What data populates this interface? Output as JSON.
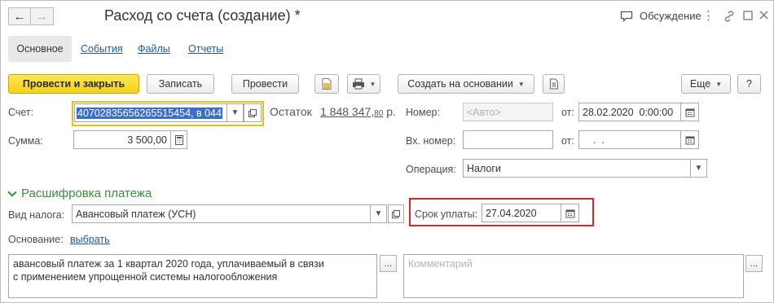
{
  "window": {
    "title": "Расход со счета (создание) *",
    "discussion_label": "Обсуждение"
  },
  "tabs": [
    {
      "label": "Основное",
      "active": true
    },
    {
      "label": "События"
    },
    {
      "label": "Файлы"
    },
    {
      "label": "Отчеты"
    }
  ],
  "toolbar": {
    "post_close": "Провести и закрыть",
    "save": "Записать",
    "post": "Провести",
    "create_based": "Создать на основании",
    "more": "Еще",
    "help": "?"
  },
  "form": {
    "account_label": "Счет:",
    "account_value": "40702835656265515454, в 044",
    "balance_label": "Остаток",
    "balance_main": "1 848 347,",
    "balance_cents": "80",
    "balance_currency": "р.",
    "number_label": "Номер:",
    "number_placeholder": "<Авто>",
    "from_label": "от:",
    "date_value": "28.02.2020  0:00:00",
    "sum_label": "Сумма:",
    "sum_value": "3 500,00",
    "incoming_number_label": "Вх. номер:",
    "incoming_number_value": "",
    "from_label2": "от:",
    "incoming_date_value": "  .  .",
    "operation_label": "Операция:",
    "operation_value": "Налоги"
  },
  "payment_section": {
    "title": "Расшифровка платежа",
    "tax_type_label": "Вид налога:",
    "tax_type_value": "Авансовый платеж (УСН)",
    "due_date_label": "Срок уплаты:",
    "due_date_value": "27.04.2020",
    "basis_label": "Основание:",
    "basis_link": "выбрать",
    "purpose_line1": "авансовый платеж за 1 квартал 2020 года, уплачиваемый в связи",
    "purpose_line2": "с применением упрощенной системы налогообложения",
    "comment_placeholder": "Комментарий"
  },
  "colors": {
    "accent_yellow": "#f3d214",
    "link_blue": "#1f59a8",
    "section_green": "#3a8f3a",
    "highlight_red": "#d9262b",
    "focus_yellow": "#e8c21c"
  }
}
